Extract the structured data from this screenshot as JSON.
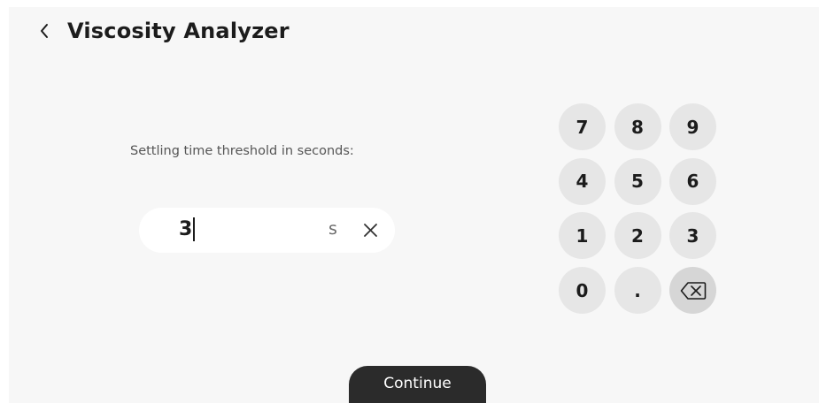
{
  "header": {
    "back_icon": "chevron-left-icon",
    "title": "Viscosity Analyzer"
  },
  "form": {
    "prompt": "Settling time threshold in seconds:",
    "value": "3",
    "unit": "s",
    "clear_icon": "close-icon"
  },
  "keypad": {
    "keys": [
      "7",
      "8",
      "9",
      "4",
      "5",
      "6",
      "1",
      "2",
      "3",
      "0",
      "."
    ],
    "backspace_icon": "backspace-icon"
  },
  "footer": {
    "continue_label": "Continue"
  },
  "colors": {
    "background": "#f7f7f7",
    "field": "#ffffff",
    "key": "#e6e6e6",
    "key_backspace": "#d6d6d6",
    "button": "#2b2b2b"
  }
}
